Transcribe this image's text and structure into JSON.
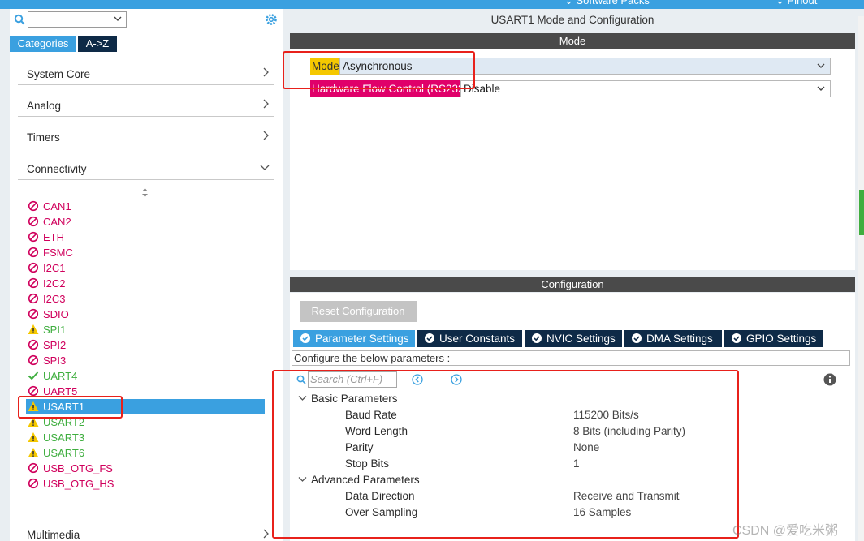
{
  "topbar": {
    "item1": "Software Packs",
    "item2": "Pinout"
  },
  "left_panel": {
    "search_value": "",
    "tabs": [
      {
        "label": "Categories"
      },
      {
        "label": "A->Z"
      }
    ],
    "categories": [
      {
        "label": "System Core",
        "expanded": false
      },
      {
        "label": "Analog",
        "expanded": false
      },
      {
        "label": "Timers",
        "expanded": false
      },
      {
        "label": "Connectivity",
        "expanded": true
      }
    ],
    "peripherals": [
      {
        "label": "CAN1",
        "status": "disabled"
      },
      {
        "label": "CAN2",
        "status": "disabled"
      },
      {
        "label": "ETH",
        "status": "disabled"
      },
      {
        "label": "FSMC",
        "status": "disabled"
      },
      {
        "label": "I2C1",
        "status": "disabled"
      },
      {
        "label": "I2C2",
        "status": "disabled"
      },
      {
        "label": "I2C3",
        "status": "disabled"
      },
      {
        "label": "SDIO",
        "status": "disabled"
      },
      {
        "label": "SPI1",
        "status": "warning"
      },
      {
        "label": "SPI2",
        "status": "disabled"
      },
      {
        "label": "SPI3",
        "status": "disabled"
      },
      {
        "label": "UART4",
        "status": "ok"
      },
      {
        "label": "UART5",
        "status": "disabled"
      },
      {
        "label": "USART1",
        "status": "warning",
        "selected": true
      },
      {
        "label": "USART2",
        "status": "warning"
      },
      {
        "label": "USART3",
        "status": "warning"
      },
      {
        "label": "USART6",
        "status": "warning"
      },
      {
        "label": "USB_OTG_FS",
        "status": "disabled"
      },
      {
        "label": "USB_OTG_HS",
        "status": "disabled"
      }
    ],
    "bottom_category": "Multimedia"
  },
  "main": {
    "title": "USART1 Mode and Configuration",
    "mode_header": "Mode",
    "mode": {
      "label": "Mode",
      "value": "Asynchronous"
    },
    "flow_control": {
      "label": "Hardware Flow Control (RS232)",
      "value": "Disable"
    },
    "config_header": "Configuration",
    "reset_button": "Reset Configuration",
    "tabs": [
      {
        "label": "Parameter Settings",
        "active": true
      },
      {
        "label": "User Constants"
      },
      {
        "label": "NVIC Settings"
      },
      {
        "label": "DMA Settings"
      },
      {
        "label": "GPIO Settings"
      }
    ],
    "configure_text": "Configure the below parameters :",
    "search_placeholder": "Search (Ctrl+F)",
    "groups": [
      {
        "label": "Basic Parameters",
        "params": [
          {
            "name": "Baud Rate",
            "value": "115200 Bits/s"
          },
          {
            "name": "Word Length",
            "value": "8 Bits (including Parity)"
          },
          {
            "name": "Parity",
            "value": "None"
          },
          {
            "name": "Stop Bits",
            "value": "1"
          }
        ]
      },
      {
        "label": "Advanced Parameters",
        "params": [
          {
            "name": "Data Direction",
            "value": "Receive and Transmit"
          },
          {
            "name": "Over Sampling",
            "value": "16 Samples"
          }
        ]
      }
    ]
  },
  "watermark": "CSDN @爱吃米粥",
  "colors": {
    "accent": "#3aa0e0",
    "dark_tab": "#0e2a47",
    "disabled": "#d0005c",
    "ok": "#3fae3f",
    "mode_label": "#f5c800",
    "flow_label": "#e0006a",
    "highlight_box": "#e8211b"
  }
}
